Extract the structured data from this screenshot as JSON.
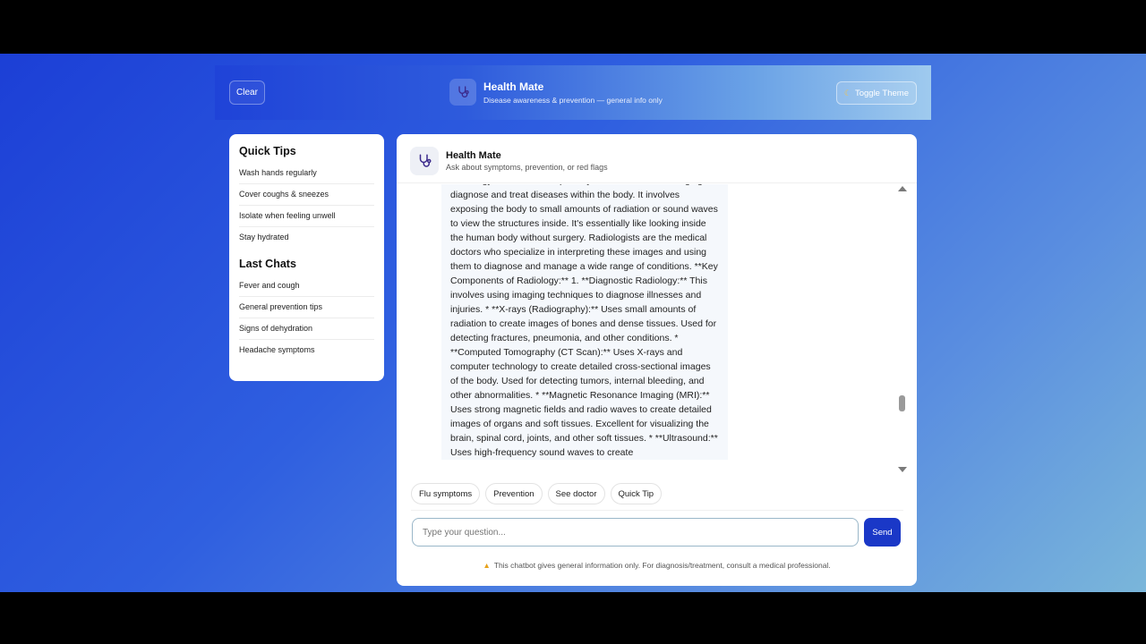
{
  "header": {
    "clear_label": "Clear",
    "title": "Health Mate",
    "subtitle": "Disease awareness & prevention — general info only",
    "theme_icon": "moon-icon",
    "theme_label": "Toggle Theme"
  },
  "sidebar": {
    "tips_title": "Quick Tips",
    "tips": [
      "Wash hands regularly",
      "Cover coughs & sneezes",
      "Isolate when feeling unwell",
      "Stay hydrated"
    ],
    "chats_title": "Last Chats",
    "chats": [
      "Fever and cough",
      "General prevention tips",
      "Signs of dehydration",
      "Headache symptoms"
    ]
  },
  "chat": {
    "title": "Health Mate",
    "subtitle": "Ask about symptoms, prevention, or red flags",
    "message": "Radiology is the medical specialty that uses medical imaging to diagnose and treat diseases within the body. It involves exposing the body to small amounts of radiation or sound waves to view the structures inside. It's essentially like looking inside the human body without surgery. Radiologists are the medical doctors who specialize in interpreting these images and using them to diagnose and manage a wide range of conditions. **Key Components of Radiology:** 1. **Diagnostic Radiology:** This involves using imaging techniques to diagnose illnesses and injuries. * **X-rays (Radiography):** Uses small amounts of radiation to create images of bones and dense tissues. Used for detecting fractures, pneumonia, and other conditions. * **Computed Tomography (CT Scan):** Uses X-rays and computer technology to create detailed cross-sectional images of the body. Used for detecting tumors, internal bleeding, and other abnormalities. * **Magnetic Resonance Imaging (MRI):** Uses strong magnetic fields and radio waves to create detailed images of organs and soft tissues. Excellent for visualizing the brain, spinal cord, joints, and other soft tissues. * **Ultrasound:** Uses high-frequency sound waves to create",
    "chips": [
      "Flu symptoms",
      "Prevention",
      "See doctor",
      "Quick Tip"
    ],
    "input_placeholder": "Type your question...",
    "send_label": "Send",
    "disclaimer": "This chatbot gives general information only. For diagnosis/treatment, consult a medical professional."
  },
  "colors": {
    "accent": "#1a38c7",
    "warning": "#e7a21a"
  }
}
